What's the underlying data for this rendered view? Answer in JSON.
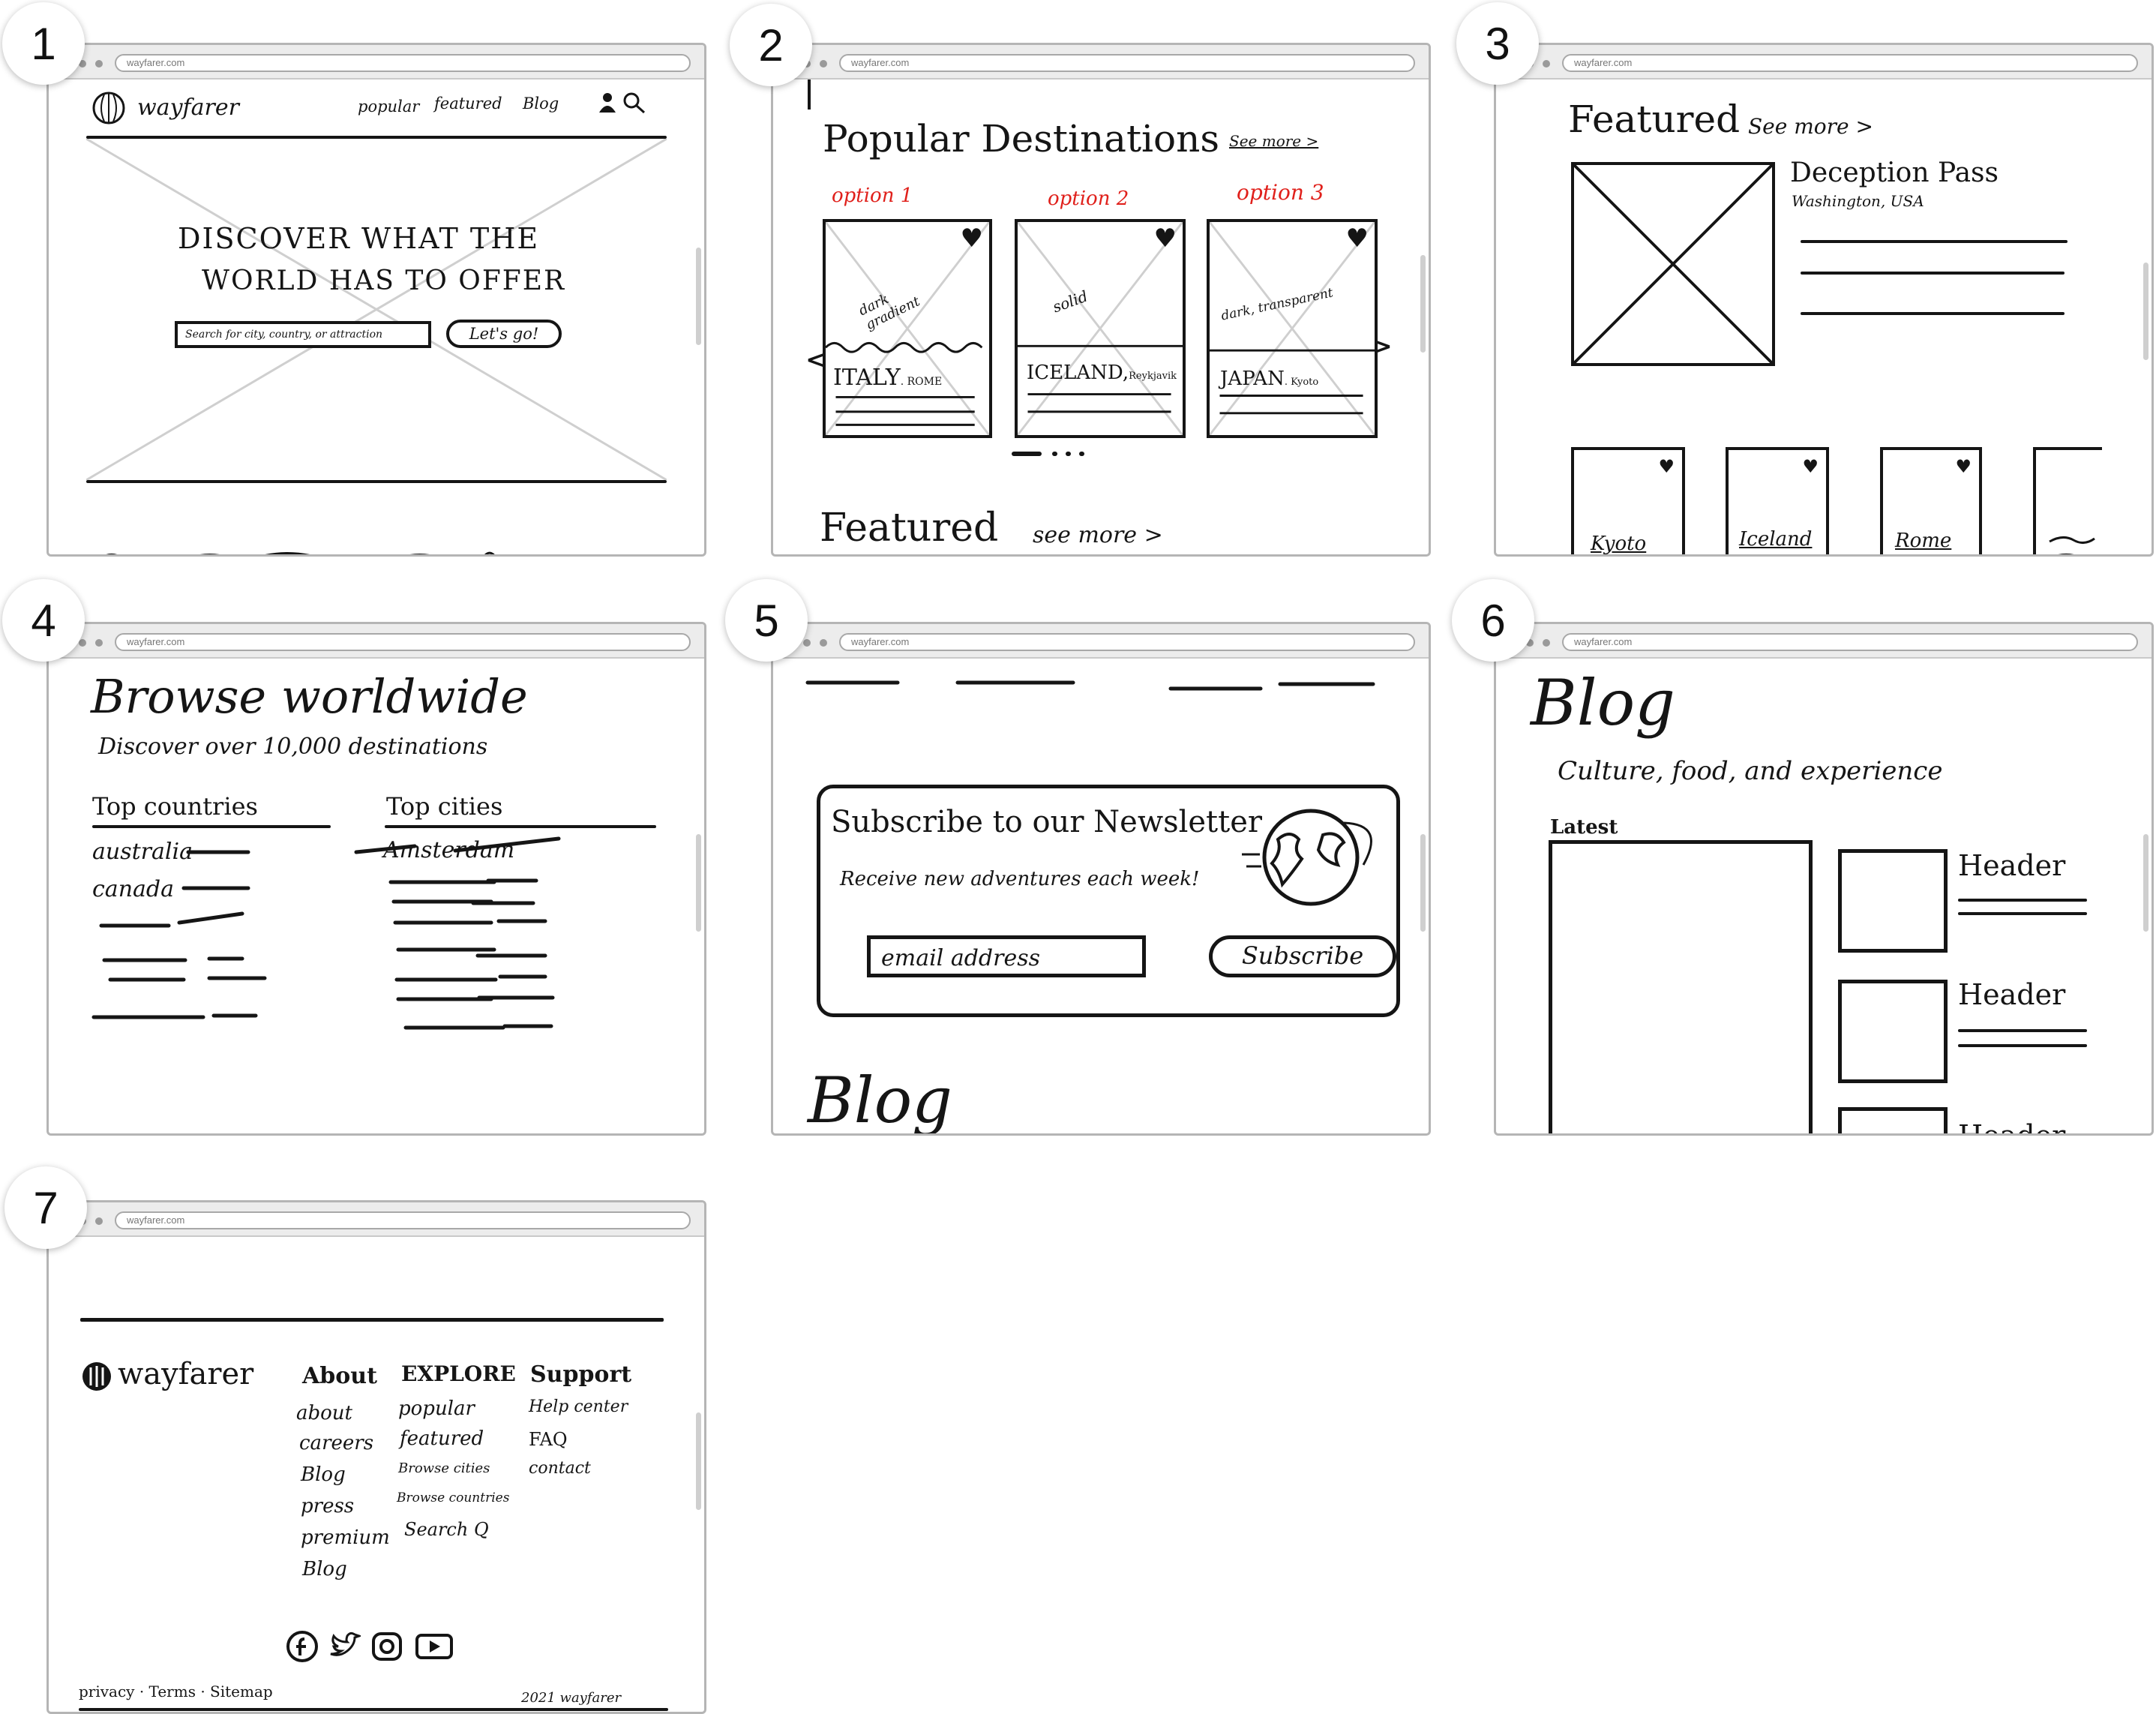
{
  "browser": {
    "url": "wayfarer.com"
  },
  "badges": [
    "1",
    "2",
    "3",
    "4",
    "5",
    "6",
    "7"
  ],
  "frame1": {
    "brand": "wayfarer",
    "nav": [
      "popular",
      "featured",
      "Blog"
    ],
    "hero_line1": "DISCOVER WHAT THE",
    "hero_line2": "WORLD HAS TO OFFER",
    "search_placeholder": "Search for city, country, or attraction",
    "cta": "Let's go!"
  },
  "frame2": {
    "heading": "Popular Destinations",
    "see_more": "See more >",
    "options": [
      {
        "option": "option 1",
        "note": "dark gradient",
        "title": "ITALY",
        "sub": ". ROME"
      },
      {
        "option": "option 2",
        "note": "solid",
        "title": "ICELAND,",
        "sub": "Reykjavik"
      },
      {
        "option": "option 3",
        "note": "dark, transparent",
        "title": "JAPAN",
        "sub": ". Kyoto"
      }
    ],
    "featured": "Featured",
    "featured_see_more": "see more >"
  },
  "frame3": {
    "heading": "Featured",
    "see_more": "See more >",
    "title": "Deception Pass",
    "location": "Washington, USA",
    "cards": [
      "Kyoto",
      "Iceland",
      "Rome"
    ]
  },
  "frame4": {
    "heading": "Browse worldwide",
    "subheading": "Discover over 10,000 destinations",
    "col1_title": "Top countries",
    "col1_items": [
      "australia",
      "canada"
    ],
    "col2_title": "Top cities",
    "col2_items": [
      "Amsterdam"
    ]
  },
  "frame5": {
    "title": "Subscribe to our Newsletter",
    "subtitle": "Receive new adventures each week!",
    "email": "email address",
    "button": "Subscribe",
    "blog": "Blog"
  },
  "frame6": {
    "heading": "Blog",
    "subheading": "Culture, food, and experience",
    "latest": "Latest",
    "items": [
      "Header",
      "Header",
      "Header"
    ]
  },
  "frame7": {
    "brand": "wayfarer",
    "cols": [
      {
        "title": "About",
        "items": [
          "about",
          "careers",
          "Blog",
          "press",
          "premium",
          "Blog"
        ]
      },
      {
        "title": "EXPLORE",
        "items": [
          "popular",
          "featured",
          "Browse cities",
          "Browse countries",
          "Search Q"
        ]
      },
      {
        "title": "Support",
        "items": [
          "Help center",
          "FAQ",
          "contact"
        ]
      }
    ],
    "legal": "privacy · Terms · Sitemap",
    "copyright": "2021 wayfarer",
    "social": [
      "facebook-icon",
      "twitter-icon",
      "instagram-icon",
      "youtube-icon"
    ]
  }
}
